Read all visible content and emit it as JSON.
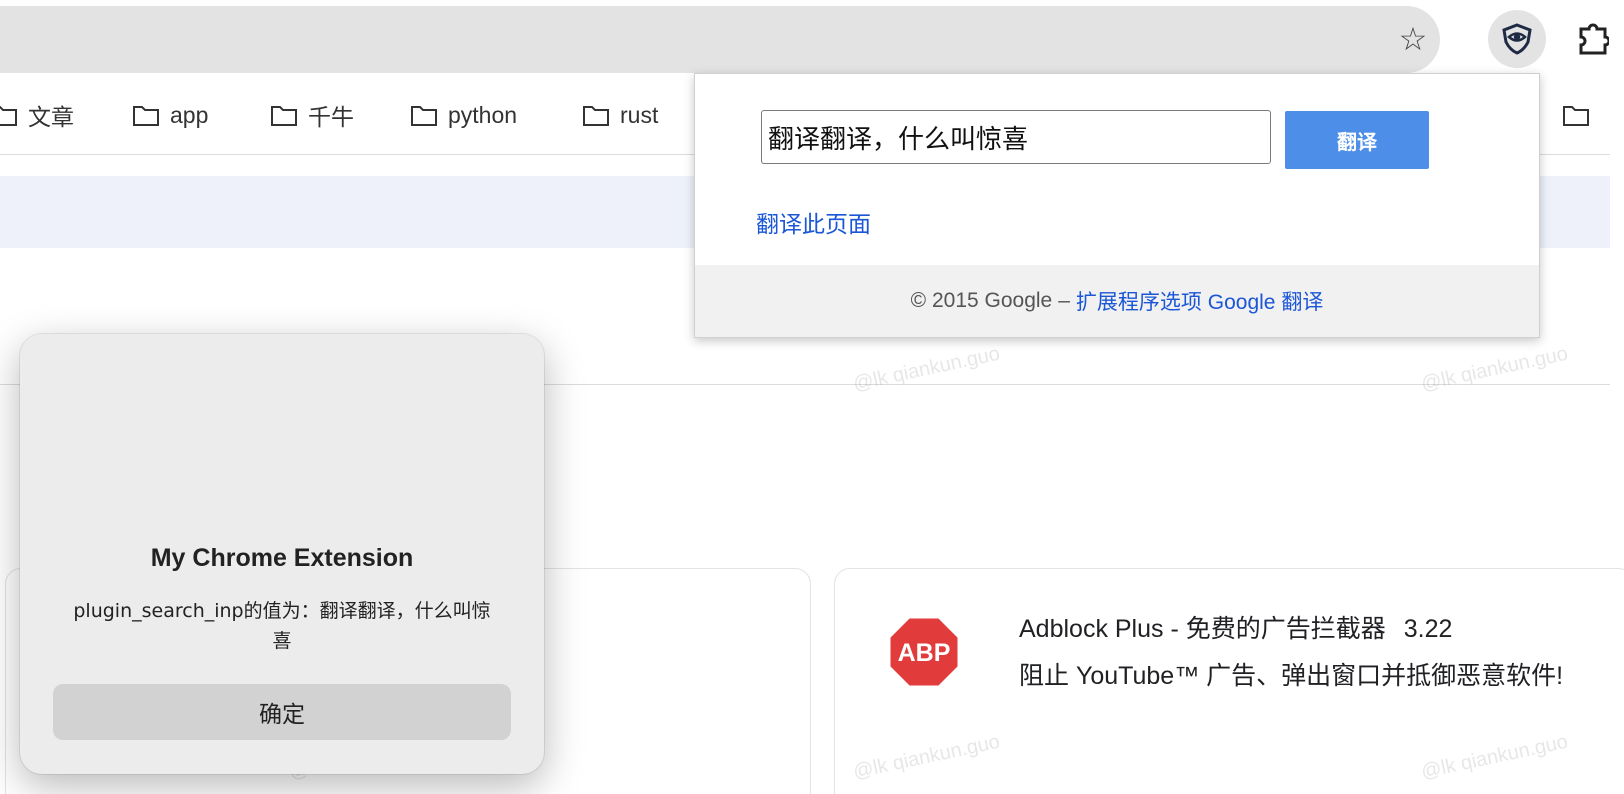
{
  "toolbar": {
    "bookmark_star": "bookmark-star-icon",
    "extension_icon": "shield-extension-icon",
    "extensions_menu": "puzzle-icon"
  },
  "bookmarks": [
    {
      "label": "文章"
    },
    {
      "label": "app"
    },
    {
      "label": "千牛"
    },
    {
      "label": "python"
    },
    {
      "label": "rust"
    }
  ],
  "translate_popup": {
    "input_value": "翻译翻译，什么叫惊喜",
    "button_label": "翻译",
    "page_link": "翻译此页面",
    "footer": {
      "copyright": "© 2015 Google",
      "separator": "–",
      "options_link": "扩展程序选项",
      "google_translate_link": "Google 翻译"
    }
  },
  "dialog": {
    "title": "My Chrome Extension",
    "message": "plugin_search_inp的值为：翻译翻译，什么叫惊喜",
    "ok_label": "确定"
  },
  "extension_card": {
    "logo_text": "ABP",
    "title": "Adblock Plus - 免费的广告拦截器",
    "version": "3.22",
    "description": "阻止 YouTube™ 广告、弹出窗口并抵御恶意软件!"
  },
  "watermark": "@lk qiankun.guo",
  "colors": {
    "accent_blue": "#4d8ee8",
    "link_blue": "#1a56d6",
    "abp_red": "#e23b3b",
    "banner_bg": "#eef1fa"
  }
}
